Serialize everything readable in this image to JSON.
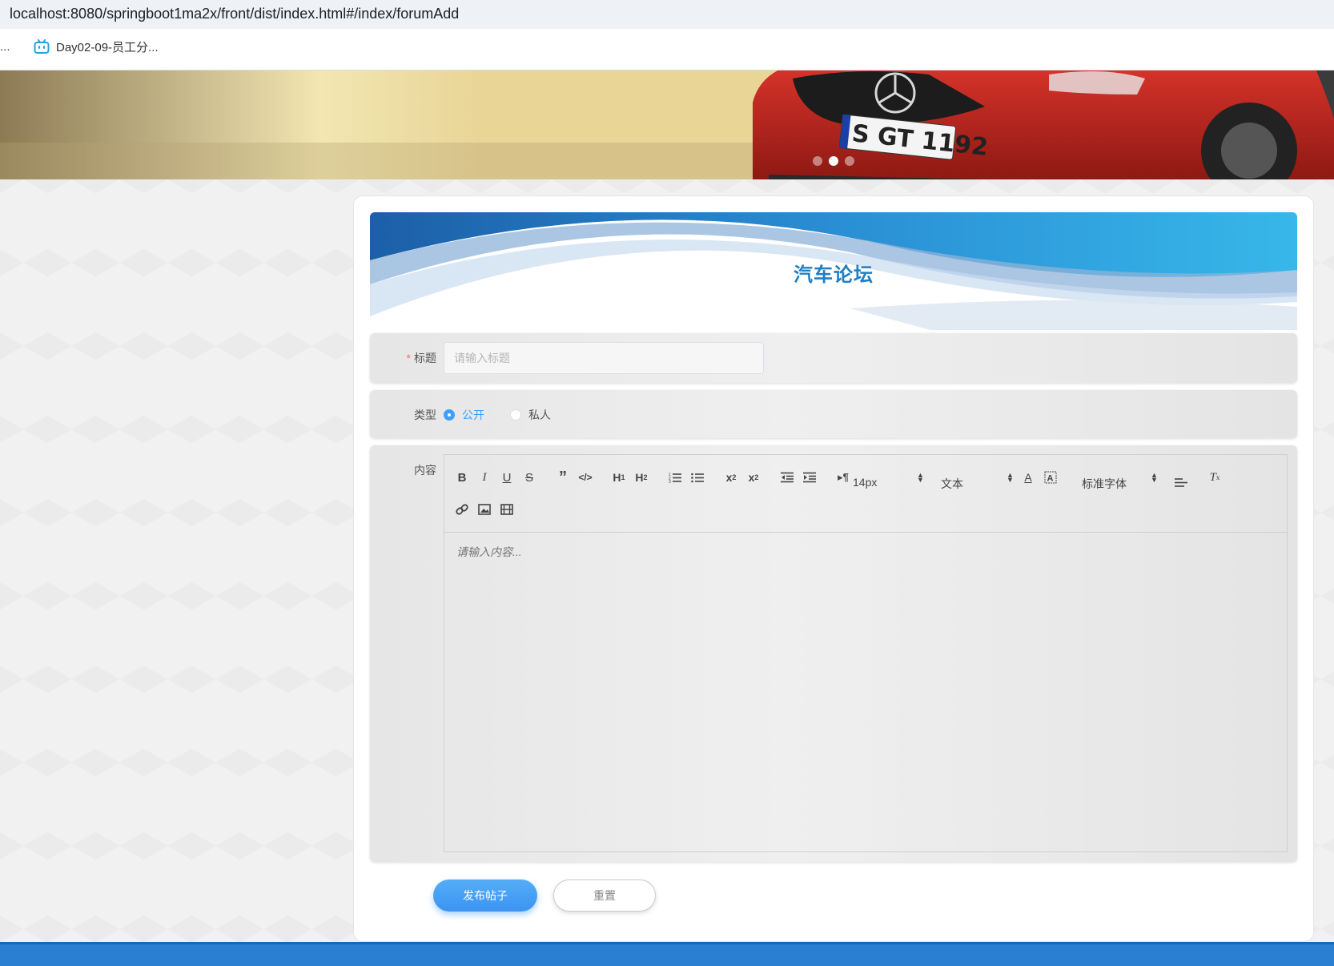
{
  "browser": {
    "url": "localhost:8080/springboot1ma2x/front/dist/index.html#/index/forumAdd",
    "bookmark_ellipsis": "...",
    "bookmark_label": "Day02-09-员工分..."
  },
  "banner": {
    "plate_text": "S GT 1192",
    "slide_count": 3,
    "active_slide": 2
  },
  "page": {
    "title": "汽车论坛"
  },
  "form": {
    "title_label": "标题",
    "title_required_mark": "*",
    "title_placeholder": "请输入标题",
    "type_label": "类型",
    "type_options": [
      "公开",
      "私人"
    ],
    "type_selected": "公开",
    "content_label": "内容",
    "content_placeholder": "请输入内容..."
  },
  "editor_toolbar": {
    "font_size": "14px",
    "header": "文本",
    "font_family": "标准字体"
  },
  "buttons": {
    "submit": "发布帖子",
    "reset": "重置"
  },
  "colors": {
    "accent": "#409eff",
    "title": "#1f7fc4",
    "footer": "#2a7fd2"
  }
}
